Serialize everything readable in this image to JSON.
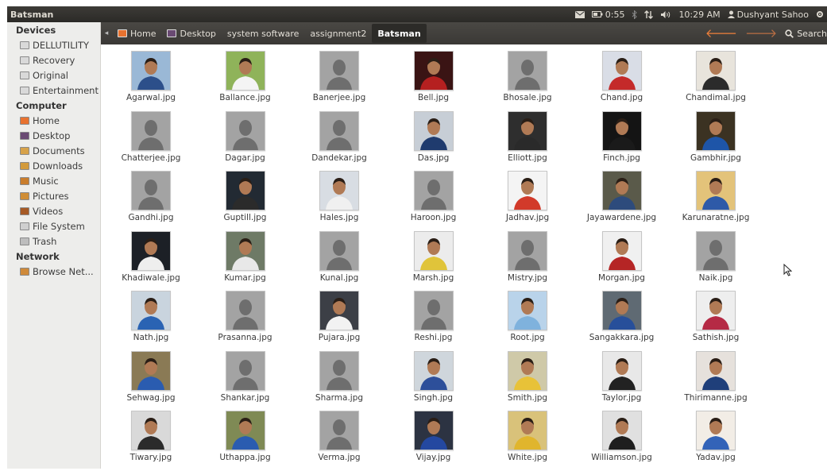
{
  "window": {
    "title": "Batsman"
  },
  "indicators": {
    "battery": "0:55",
    "time": "10:29 AM",
    "user": "Dushyant Sahoo"
  },
  "sidebar": {
    "sections": [
      {
        "title": "Devices",
        "items": [
          {
            "label": "DELLUTILITY",
            "icon": "drive-icon"
          },
          {
            "label": "Recovery",
            "icon": "drive-icon"
          },
          {
            "label": "Original",
            "icon": "drive-icon"
          },
          {
            "label": "Entertainment",
            "icon": "drive-icon"
          }
        ]
      },
      {
        "title": "Computer",
        "items": [
          {
            "label": "Home",
            "icon": "home-folder-icon"
          },
          {
            "label": "Desktop",
            "icon": "desktop-icon"
          },
          {
            "label": "Documents",
            "icon": "documents-icon"
          },
          {
            "label": "Downloads",
            "icon": "downloads-icon"
          },
          {
            "label": "Music",
            "icon": "music-icon"
          },
          {
            "label": "Pictures",
            "icon": "pictures-icon"
          },
          {
            "label": "Videos",
            "icon": "videos-icon"
          },
          {
            "label": "File System",
            "icon": "filesystem-icon"
          },
          {
            "label": "Trash",
            "icon": "trash-icon"
          }
        ]
      },
      {
        "title": "Network",
        "items": [
          {
            "label": "Browse Net...",
            "icon": "network-icon"
          }
        ]
      }
    ]
  },
  "breadcrumbs": [
    {
      "label": "Home",
      "icon": "home-folder-icon"
    },
    {
      "label": "Desktop",
      "icon": "desktop-icon"
    },
    {
      "label": "system software",
      "icon": ""
    },
    {
      "label": "assignment2",
      "icon": ""
    },
    {
      "label": "Batsman",
      "icon": "",
      "active": true
    }
  ],
  "toolbar": {
    "search_label": "Search"
  },
  "files": [
    {
      "name": "Agarwal.jpg",
      "photo": true,
      "bg": "#9ab8d6",
      "shirt": "#2c4f8a"
    },
    {
      "name": "Ballance.jpg",
      "photo": true,
      "bg": "#8fb35a",
      "shirt": "#f4f4f4"
    },
    {
      "name": "Banerjee.jpg",
      "photo": false
    },
    {
      "name": "Bell.jpg",
      "photo": true,
      "bg": "#3a1414",
      "shirt": "#b52020"
    },
    {
      "name": "Bhosale.jpg",
      "photo": false
    },
    {
      "name": "Chand.jpg",
      "photo": true,
      "bg": "#d9dde6",
      "shirt": "#c42a2a"
    },
    {
      "name": "Chandimal.jpg",
      "photo": true,
      "bg": "#e8e4dc",
      "shirt": "#2b2b2b"
    },
    {
      "name": "Chatterjee.jpg",
      "photo": false
    },
    {
      "name": "Dagar.jpg",
      "photo": false
    },
    {
      "name": "Dandekar.jpg",
      "photo": false
    },
    {
      "name": "Das.jpg",
      "photo": true,
      "bg": "#c7ced6",
      "shirt": "#1f3b6e"
    },
    {
      "name": "Elliott.jpg",
      "photo": true,
      "bg": "#2e2e2e",
      "shirt": "#2a2a2a"
    },
    {
      "name": "Finch.jpg",
      "photo": true,
      "bg": "#141414",
      "shirt": "#1a1a1a"
    },
    {
      "name": "Gambhir.jpg",
      "photo": true,
      "bg": "#3b3222",
      "shirt": "#1e55a8"
    },
    {
      "name": "Gandhi.jpg",
      "photo": false
    },
    {
      "name": "Guptill.jpg",
      "photo": true,
      "bg": "#222a33",
      "shirt": "#2b2b2b"
    },
    {
      "name": "Hales.jpg",
      "photo": true,
      "bg": "#d8dde3",
      "shirt": "#f0f0f0"
    },
    {
      "name": "Haroon.jpg",
      "photo": false
    },
    {
      "name": "Jadhav.jpg",
      "photo": true,
      "bg": "#f4f4f4",
      "shirt": "#d23a2a"
    },
    {
      "name": "Jayawardene.jpg",
      "photo": true,
      "bg": "#5a5a4a",
      "shirt": "#2d4b7c"
    },
    {
      "name": "Karunaratne.jpg",
      "photo": true,
      "bg": "#e3c37a",
      "shirt": "#2e5aa8"
    },
    {
      "name": "Khadiwale.jpg",
      "photo": true,
      "bg": "#1c2026",
      "shirt": "#eeeeee"
    },
    {
      "name": "Kumar.jpg",
      "photo": true,
      "bg": "#6e7a66",
      "shirt": "#e8e8e8"
    },
    {
      "name": "Kunal.jpg",
      "photo": false
    },
    {
      "name": "Marsh.jpg",
      "photo": true,
      "bg": "#ececec",
      "shirt": "#e0c43a"
    },
    {
      "name": "Mistry.jpg",
      "photo": false
    },
    {
      "name": "Morgan.jpg",
      "photo": true,
      "bg": "#f0f0f0",
      "shirt": "#b52525"
    },
    {
      "name": "Naik.jpg",
      "photo": false
    },
    {
      "name": "Nath.jpg",
      "photo": true,
      "bg": "#c9d4de",
      "shirt": "#2a63b3"
    },
    {
      "name": "Prasanna.jpg",
      "photo": false
    },
    {
      "name": "Pujara.jpg",
      "photo": true,
      "bg": "#3c3f46",
      "shirt": "#f2f2f2"
    },
    {
      "name": "Reshi.jpg",
      "photo": false
    },
    {
      "name": "Root.jpg",
      "photo": true,
      "bg": "#b9d3ea",
      "shirt": "#7fb2dd"
    },
    {
      "name": "Sangakkara.jpg",
      "photo": true,
      "bg": "#5f6a73",
      "shirt": "#274f9a"
    },
    {
      "name": "Sathish.jpg",
      "photo": true,
      "bg": "#eeeeee",
      "shirt": "#b52a45"
    },
    {
      "name": "Sehwag.jpg",
      "photo": true,
      "bg": "#8a7a55",
      "shirt": "#2a5cb0"
    },
    {
      "name": "Shankar.jpg",
      "photo": false
    },
    {
      "name": "Sharma.jpg",
      "photo": false
    },
    {
      "name": "Singh.jpg",
      "photo": true,
      "bg": "#cfd6dc",
      "shirt": "#2d4f9a"
    },
    {
      "name": "Smith.jpg",
      "photo": true,
      "bg": "#cfc9a8",
      "shirt": "#e8c238"
    },
    {
      "name": "Taylor.jpg",
      "photo": true,
      "bg": "#e8e8e8",
      "shirt": "#222222"
    },
    {
      "name": "Thirimanne.jpg",
      "photo": true,
      "bg": "#e6e1dc",
      "shirt": "#1f3f7a"
    },
    {
      "name": "Tiwary.jpg",
      "photo": true,
      "bg": "#d9d9d9",
      "shirt": "#2b2b2b"
    },
    {
      "name": "Uthappa.jpg",
      "photo": true,
      "bg": "#7f8a55",
      "shirt": "#2a5cb0"
    },
    {
      "name": "Verma.jpg",
      "photo": false
    },
    {
      "name": "Vijay.jpg",
      "photo": true,
      "bg": "#2c3342",
      "shirt": "#2448a0"
    },
    {
      "name": "White.jpg",
      "photo": true,
      "bg": "#d9c27a",
      "shirt": "#e0b52d"
    },
    {
      "name": "Williamson.jpg",
      "photo": true,
      "bg": "#e0e0e0",
      "shirt": "#1e1e1e"
    },
    {
      "name": "Yadav.jpg",
      "photo": true,
      "bg": "#f2ede6",
      "shirt": "#3363b8"
    }
  ],
  "colors": {
    "placeholder_bg": "#a3a3a3",
    "placeholder_fg": "#6e6e6e",
    "accent": "#ee7f3a"
  }
}
